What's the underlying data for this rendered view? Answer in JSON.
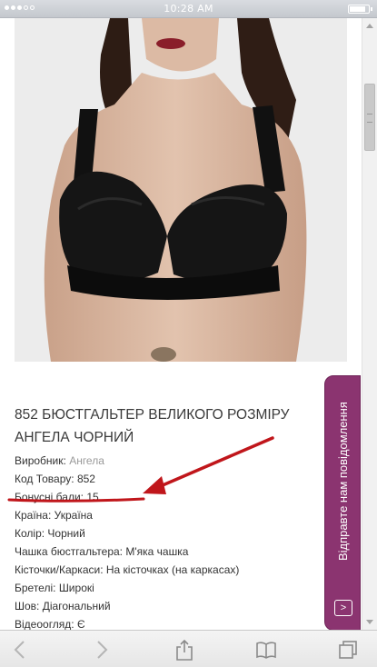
{
  "status_bar": {
    "time": "10:28 AM",
    "signal_icon": "signal-dots-icon",
    "battery_icon": "battery-icon"
  },
  "product": {
    "image_icon": "product-photo-black-bra",
    "title": "852 БЮСТГАЛЬТЕР ВЕЛИКОГО РОЗМІРУ АНГЕЛА ЧОРНИЙ",
    "specs": [
      {
        "label": "Виробник:",
        "value": "Ангела"
      },
      {
        "label": "Код Товару:",
        "value": "852"
      },
      {
        "label": "Бонусні бали:",
        "value": "15"
      },
      {
        "label": "Країна:",
        "value": "Україна"
      },
      {
        "label": "Колір:",
        "value": "Чорний"
      },
      {
        "label": "Чашка бюстгальтера:",
        "value": "М'яка чашка"
      },
      {
        "label": "Кісточки/Каркаси:",
        "value": "На кісточках (на каркасах)"
      },
      {
        "label": "Бретелі:",
        "value": "Широкі"
      },
      {
        "label": "Шов:",
        "value": "Діагональний"
      },
      {
        "label": "Відеоогляд:",
        "value": "Є"
      }
    ]
  },
  "feedback": {
    "label": "Відправте нам повідомлення",
    "arrow_icon": "chevron-right-icon",
    "color": "#8b3470"
  },
  "annotation": {
    "color": "#c0161b"
  },
  "toolbar": {
    "back_icon": "back-arrow-icon",
    "forward_icon": "forward-arrow-icon",
    "share_icon": "share-icon",
    "bookmarks_icon": "book-icon",
    "tabs_icon": "tabs-icon"
  }
}
